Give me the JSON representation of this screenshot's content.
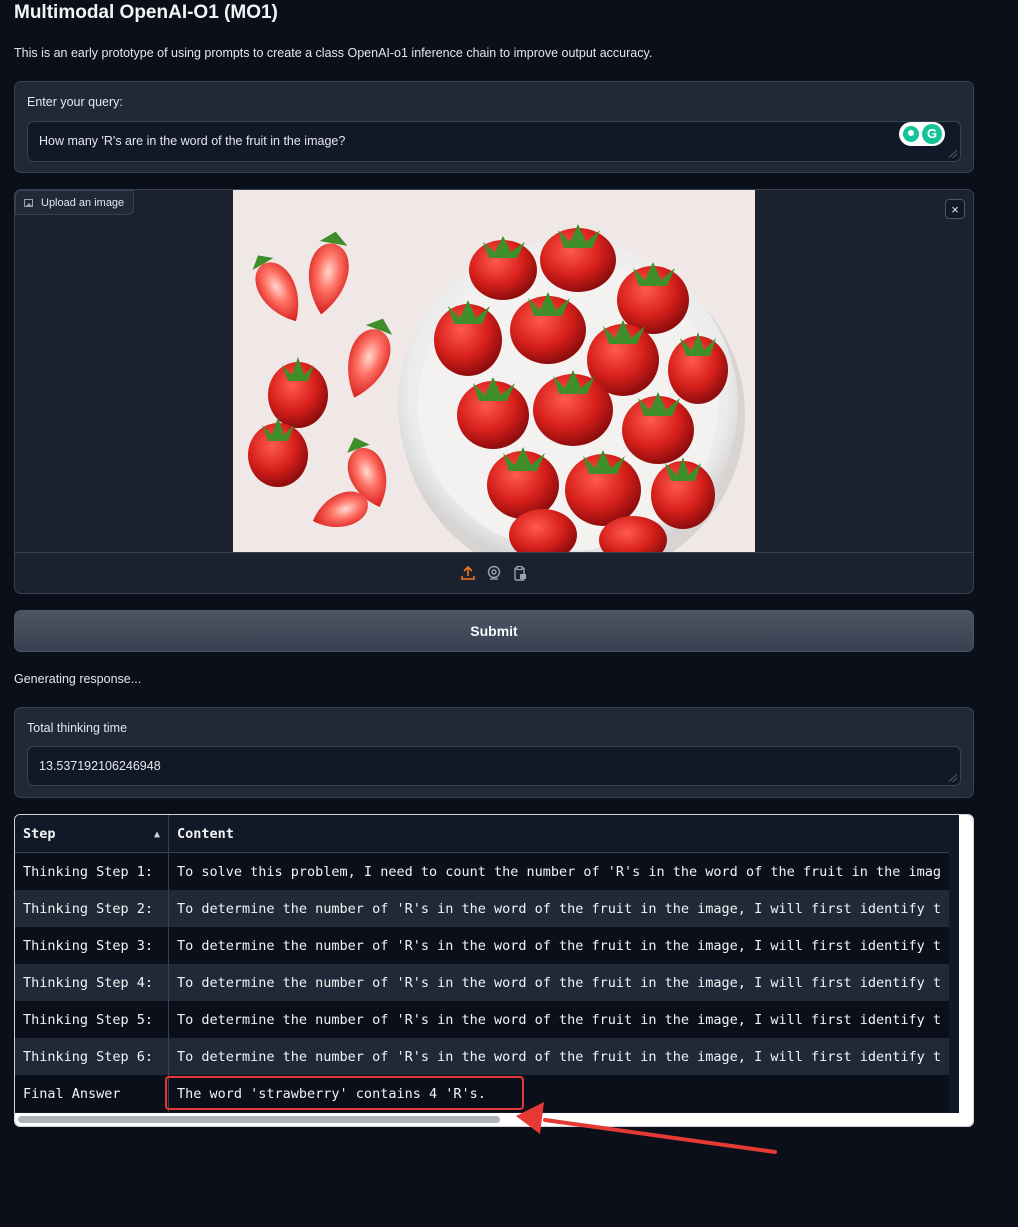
{
  "app": {
    "title": "Multimodal OpenAI-O1 (MO1)",
    "description": "This is an early prototype of using prompts to create a class OpenAI-o1 inference chain to improve output accuracy."
  },
  "query": {
    "label": "Enter your query:",
    "value": "How many 'R's are in the word of the fruit in the image?"
  },
  "image_upload": {
    "badge_label": "Upload an image",
    "close_symbol": "×",
    "photo_icon": "strawberries-photo",
    "footer_icons": [
      "upload-icon",
      "webcam-icon",
      "clipboard-icon"
    ],
    "accent_color": "#f97316"
  },
  "submit": {
    "label": "Submit"
  },
  "status": {
    "text": "Generating response..."
  },
  "thinking_time": {
    "label": "Total thinking time",
    "value": "13.537192106246948"
  },
  "results": {
    "headers": [
      "Step",
      "Content"
    ],
    "sort_indicator": "▲",
    "rows": [
      [
        "Thinking Step 1:",
        "To solve this problem, I need to count the number of 'R's in the word of the fruit in the imag"
      ],
      [
        "Thinking Step 2:",
        "To determine the number of 'R's in the word of the fruit in the image, I will first identify t"
      ],
      [
        "Thinking Step 3:",
        "To determine the number of 'R's in the word of the fruit in the image, I will first identify t"
      ],
      [
        "Thinking Step 4:",
        "To determine the number of 'R's in the word of the fruit in the image, I will first identify t"
      ],
      [
        "Thinking Step 5:",
        "To determine the number of 'R's in the word of the fruit in the image, I will first identify t"
      ],
      [
        "Thinking Step 6:",
        "To determine the number of 'R's in the word of the fruit in the image, I will first identify t"
      ],
      [
        "Final Answer",
        "The word 'strawberry' contains 4 'R's."
      ]
    ]
  },
  "annotation": {
    "color": "#e53935"
  }
}
